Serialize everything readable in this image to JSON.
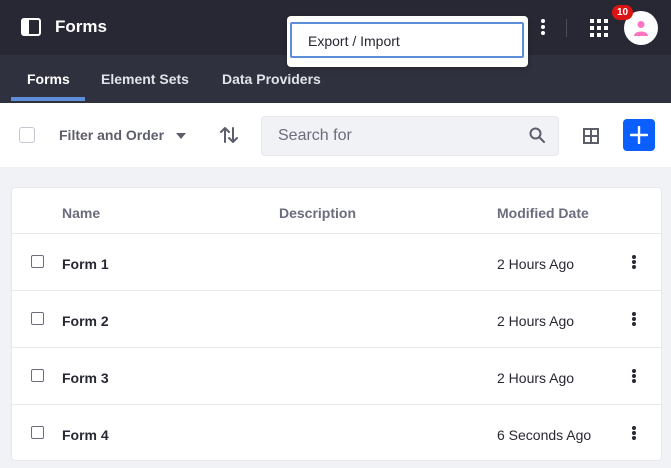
{
  "header": {
    "title": "Forms",
    "notifications_count": "10"
  },
  "dropdown": {
    "items": [
      {
        "label": "Export / Import"
      }
    ]
  },
  "tabs": [
    {
      "label": "Forms",
      "active": true
    },
    {
      "label": "Element Sets",
      "active": false
    },
    {
      "label": "Data Providers",
      "active": false
    }
  ],
  "toolbar": {
    "filter_label": "Filter and Order",
    "search_placeholder": "Search for"
  },
  "table": {
    "columns": [
      "Name",
      "Description",
      "Modified Date"
    ],
    "rows": [
      {
        "name": "Form 1",
        "description": "",
        "modified": "2 Hours Ago"
      },
      {
        "name": "Form 2",
        "description": "",
        "modified": "2 Hours Ago"
      },
      {
        "name": "Form 3",
        "description": "",
        "modified": "2 Hours Ago"
      },
      {
        "name": "Form 4",
        "description": "",
        "modified": "6 Seconds Ago"
      }
    ]
  },
  "colors": {
    "appbar": "#272833",
    "tabbar": "#30313f",
    "accent": "#0b5fff",
    "tab_underline": "#5f8ed9",
    "badge": "#da1414",
    "avatar_icon": "#ff73c3"
  },
  "icons": [
    "panel-toggle-icon",
    "ellipsis-v-icon",
    "apps-icon",
    "user-icon",
    "caret-down-icon",
    "sort-icon",
    "search-icon",
    "cards-icon",
    "plus-icon"
  ]
}
